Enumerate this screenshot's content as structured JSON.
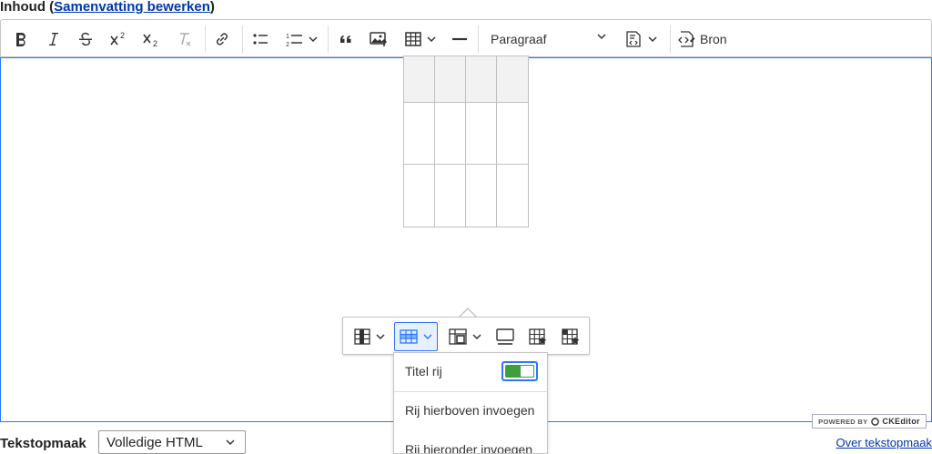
{
  "field": {
    "label": "Inhoud",
    "open_paren": "(",
    "summary_link": "Samenvatting bewerken",
    "close_paren": ")"
  },
  "toolbar": {
    "buttons": [
      "bold-icon",
      "italic-icon",
      "strikethrough-icon",
      "superscript-icon",
      "subscript-icon",
      "remove-format-icon",
      "link-icon",
      "bulleted-list-icon",
      "numbered-list-icon",
      "blockquote-icon",
      "insert-image-icon",
      "insert-table-icon",
      "horizontal-line-icon",
      "code-block-icon",
      "source-icon"
    ],
    "heading_select": "Paragraaf",
    "source_label": "Bron"
  },
  "table": {
    "columns": 4,
    "rows": 3,
    "header_rows": 1
  },
  "table_toolbar": {
    "buttons": [
      "table-column-icon",
      "table-row-icon",
      "merge-cells-icon",
      "table-caption-icon",
      "table-properties-icon",
      "cell-properties-icon"
    ],
    "active": "table-row-icon"
  },
  "row_menu": {
    "items": [
      {
        "label": "Titel rij",
        "toggle_on": true
      },
      {
        "label": "Rij hierboven invoegen"
      },
      {
        "label": "Rij hieronder invoegen"
      }
    ]
  },
  "powered_by": {
    "prefix": "POWERED BY",
    "brand": "CKEditor"
  },
  "text_format": {
    "label": "Tekstopmaak",
    "selected": "Volledige HTML",
    "about_link": "Over tekstopmaak"
  },
  "colors": {
    "focus_border": "#2977ff",
    "toggle_on": "#3f9e3f",
    "link": "#0036b1",
    "header_cell": "#f2f2f2"
  }
}
